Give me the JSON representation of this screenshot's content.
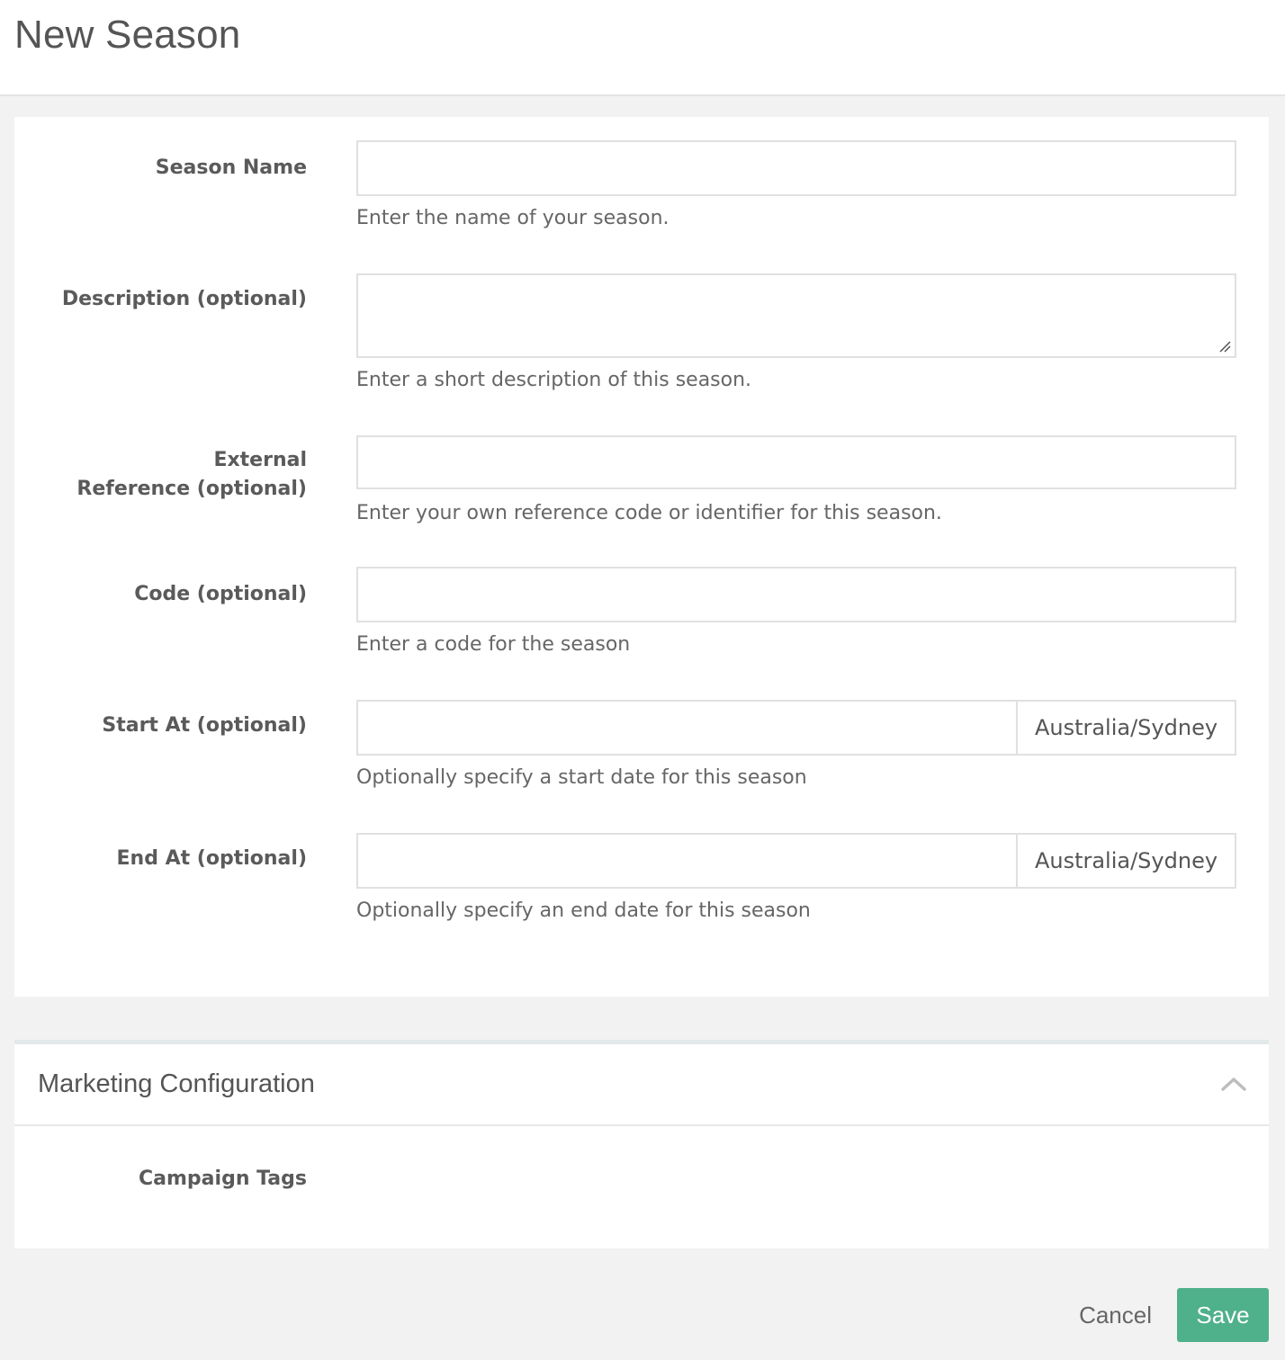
{
  "page": {
    "title": "New Season"
  },
  "form": {
    "season_name": {
      "label": "Season Name",
      "value": "",
      "help": "Enter the name of your season."
    },
    "description": {
      "label": "Description (optional)",
      "value": "",
      "help": "Enter a short description of this season."
    },
    "external_reference": {
      "label_line1": "External",
      "label_line2": "Reference (optional)",
      "value": "",
      "help": "Enter your own reference code or identifier for this season."
    },
    "code": {
      "label": "Code (optional)",
      "value": "",
      "help": "Enter a code for the season"
    },
    "start_at": {
      "label": "Start At (optional)",
      "value": "",
      "timezone": "Australia/Sydney",
      "help": "Optionally specify a start date for this season"
    },
    "end_at": {
      "label": "End At (optional)",
      "value": "",
      "timezone": "Australia/Sydney",
      "help": "Optionally specify an end date for this season"
    }
  },
  "marketing": {
    "title": "Marketing Configuration",
    "campaign_tags_label": "Campaign Tags",
    "expanded": true
  },
  "actions": {
    "cancel_label": "Cancel",
    "save_label": "Save"
  },
  "colors": {
    "save_button": "#4fb08c",
    "background": "#f2f2f2"
  },
  "icons": {
    "collapse": "chevron-up-icon",
    "resize": "resize-grip-icon"
  }
}
